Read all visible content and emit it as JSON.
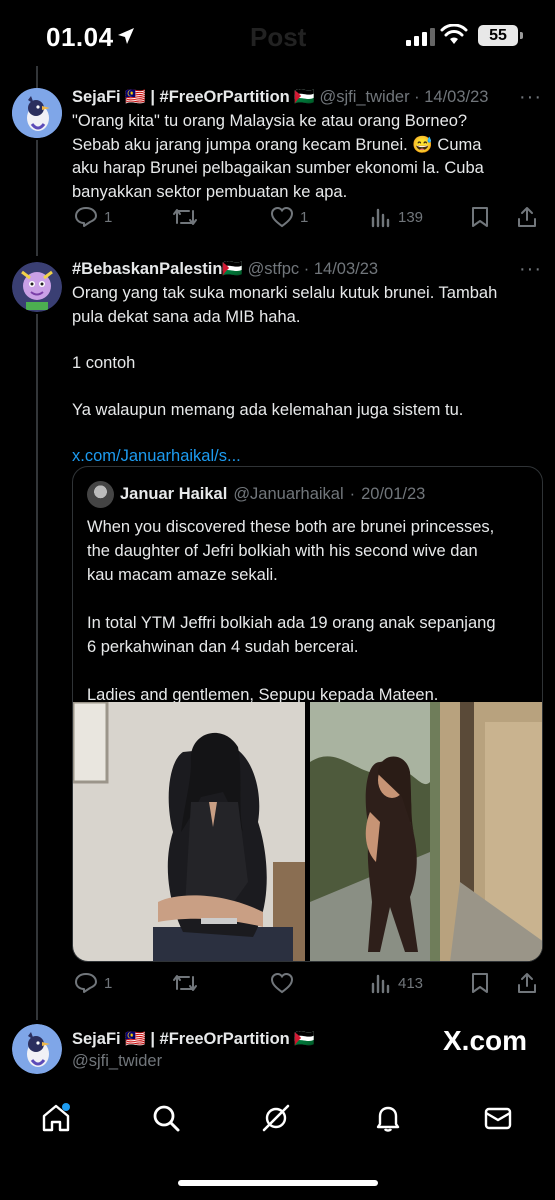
{
  "status_bar": {
    "time": "01.04",
    "ghost_title": "Post",
    "battery": "55"
  },
  "tweets": [
    {
      "display_name": "SejaFi 🇲🇾 | #FreeOrPartition 🇵🇸",
      "handle": "@sjfi_twider",
      "date": "14/03/23",
      "lines": [
        "\"Orang kita\" tu orang Malaysia ke atau orang Borneo?",
        "Sebab aku jarang jumpa orang kecam Brunei. 😅 Cuma",
        "aku harap Brunei pelbagaikan sumber ekonomi la. Cuba",
        "banyakkan sektor pembuatan ke apa."
      ],
      "replies": "1",
      "retweets": "",
      "likes": "1",
      "views": "139"
    },
    {
      "display_name": "#BebaskanPalestin🇵🇸",
      "handle": "@stfpc",
      "date": "14/03/23",
      "lines": [
        "Orang yang tak suka monarki selalu kutuk brunei. Tambah",
        "pula dekat sana ada MIB haha."
      ],
      "line_example": "1 contoh",
      "line_weakness": "Ya walaupun memang ada kelemahan juga sistem tu.",
      "link": "x.com/Januarhaikal/s...",
      "replies": "1",
      "retweets": "",
      "likes": "",
      "views": "413"
    }
  ],
  "quoted": {
    "display_name": "Januar Haikal",
    "handle": "@Januarhaikal",
    "date": "20/01/23",
    "para1": [
      "When you discovered these both are brunei princesses,",
      "the daughter of Jefri bolkiah with his second wive dan",
      "kau macam amaze sekali."
    ],
    "para2": [
      "In total YTM Jeffri bolkiah ada 19 orang anak sepanjang",
      "6 perkahwinan dan 4 sudah bercerai."
    ],
    "para3": "Ladies and gentlemen, Sepupu kepada Mateen."
  },
  "footer": {
    "display_name": "SejaFi 🇲🇾 | #FreeOrPartition 🇵🇸",
    "handle": "@sjfi_twider",
    "watermark": "X.com"
  },
  "separator": "·",
  "icons": {
    "reply": "reply-icon",
    "retweet": "retweet-icon",
    "like": "heart-icon",
    "views": "views-icon",
    "bookmark": "bookmark-icon",
    "share": "share-icon",
    "home": "home-icon",
    "search": "search-icon",
    "grok": "grok-icon",
    "notifications": "bell-icon",
    "messages": "mail-icon"
  },
  "colors": {
    "background": "#000000",
    "text": "#e7e9ea",
    "muted": "#71767b",
    "link": "#1d9bf0"
  }
}
